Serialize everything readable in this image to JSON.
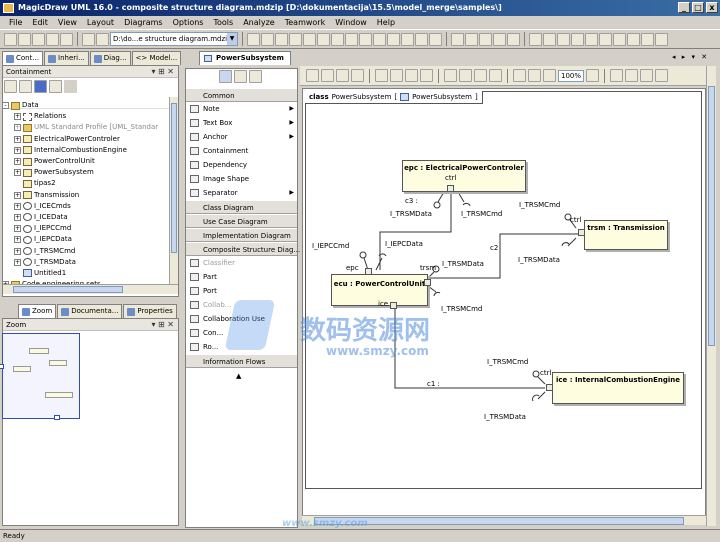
{
  "window": {
    "title": "MagicDraw UML 16.0 - composite structure diagram.mdzip [D:\\dokumentacija\\15.5\\model_merge\\samples\\]",
    "buttons": [
      "_",
      "□",
      "x"
    ]
  },
  "menu": [
    "File",
    "Edit",
    "View",
    "Layout",
    "Diagrams",
    "Options",
    "Tools",
    "Analyze",
    "Teamwork",
    "Window",
    "Help"
  ],
  "toolbar": {
    "diagram_combo": "D:\\do...e structure diagram.mdzip"
  },
  "left_tabs": [
    "Cont...",
    "Inheri...",
    "Diag...",
    "<> Model..."
  ],
  "containment": {
    "title": "Containment",
    "tree": [
      {
        "label": "Data",
        "level": 0,
        "icon": "pkg",
        "exp": "-"
      },
      {
        "label": "Relations",
        "level": 1,
        "icon": "rel",
        "exp": "+"
      },
      {
        "label": "UML Standard Profile [UML_Standar",
        "level": 1,
        "icon": "pkg",
        "exp": "+",
        "grey": true
      },
      {
        "label": "ElectricalPowerControler",
        "level": 1,
        "icon": "cls",
        "exp": "+"
      },
      {
        "label": "InternalCombustionEngine",
        "level": 1,
        "icon": "cls",
        "exp": "+"
      },
      {
        "label": "PowerControlUnit",
        "level": 1,
        "icon": "cls",
        "exp": "+"
      },
      {
        "label": "PowerSubsystem",
        "level": 1,
        "icon": "cls",
        "exp": "+"
      },
      {
        "label": "tipas2",
        "level": 1,
        "icon": "cls",
        "exp": ""
      },
      {
        "label": "Transmission",
        "level": 1,
        "icon": "cls",
        "exp": "+"
      },
      {
        "label": "I_ICECmds",
        "level": 1,
        "icon": "itf",
        "exp": "+"
      },
      {
        "label": "I_ICEData",
        "level": 1,
        "icon": "itf",
        "exp": "+"
      },
      {
        "label": "I_IEPCCmd",
        "level": 1,
        "icon": "itf",
        "exp": "+"
      },
      {
        "label": "I_IEPCData",
        "level": 1,
        "icon": "itf",
        "exp": "+"
      },
      {
        "label": "I_TRSMCmd",
        "level": 1,
        "icon": "itf",
        "exp": "+"
      },
      {
        "label": "I_TRSMData",
        "level": 1,
        "icon": "itf",
        "exp": "+"
      },
      {
        "label": "Untitled1",
        "level": 1,
        "icon": "dia",
        "exp": ""
      },
      {
        "label": "Code engineering sets",
        "level": 0,
        "icon": "pkg",
        "exp": "+"
      }
    ]
  },
  "bottom_tabs": [
    "Zoom",
    "Documenta...",
    "Properties"
  ],
  "zoom_pane": {
    "title": "Zoom"
  },
  "palette": {
    "items": [
      {
        "label": "Common",
        "type": "grp"
      },
      {
        "label": "Note",
        "arrow": true
      },
      {
        "label": "Text Box",
        "arrow": true
      },
      {
        "label": "Anchor",
        "arrow": true
      },
      {
        "label": "Containment"
      },
      {
        "label": "Dependency"
      },
      {
        "label": "Image Shape"
      },
      {
        "label": "Separator",
        "arrow": true
      },
      {
        "label": "Class Diagram",
        "type": "grp"
      },
      {
        "label": "Use Case Diagram",
        "type": "grp"
      },
      {
        "label": "Implementation Diagram",
        "type": "grp"
      },
      {
        "label": "Composite Structure Diag...",
        "type": "grp"
      },
      {
        "label": "Classifier",
        "dis": true
      },
      {
        "label": "Part"
      },
      {
        "label": "Port"
      },
      {
        "label": "Collab...",
        "dis": true
      },
      {
        "label": "Collaboration Use"
      },
      {
        "label": "Con..."
      },
      {
        "label": "Ro..."
      },
      {
        "label": "Information Flows",
        "type": "grp"
      }
    ]
  },
  "editor": {
    "tab": "PowerSubsystem",
    "zoom": "100%",
    "frame_keyword": "class",
    "frame_name": "PowerSubsystem",
    "frame_name2": "PowerSubsystem"
  },
  "diagram": {
    "parts": {
      "epc": "epc : ElectricalPowerControler",
      "ecu": "ecu : PowerControlUnit",
      "trsm": "trsm : Transmission",
      "ice": "ice : InternalCombustionEngine"
    },
    "labels": {
      "ctrl_epc": "ctrl",
      "ctrl_trsm": "ctrl",
      "ctrl_ice": "ctrl",
      "epc_port": "epc",
      "trsm_port": "trsm",
      "ice_port": "ice",
      "c1": "c1 :",
      "c2": "c2",
      "c3": "c3 :",
      "trsmdata1": "I_TRSMData",
      "trsmcmd1": "I_TRSMCmd",
      "trsmcmd2": "I_TRSMCmd",
      "trsmdata2": "I_TRSMData",
      "iepccmd": "I_IEPCCmd",
      "iepcdata": "I_IEPCData",
      "trsmdata3": "I_TRSMData",
      "trsmcmd3": "I_TRSMCmd",
      "trsmcmd4": "I_TRSMCmd",
      "trsmdata4": "I_TRSMData"
    }
  },
  "watermark": {
    "line1": "数码资源网",
    "line2": "www.smzy.com",
    "line3": "www.smzy.com"
  },
  "status": "Ready"
}
